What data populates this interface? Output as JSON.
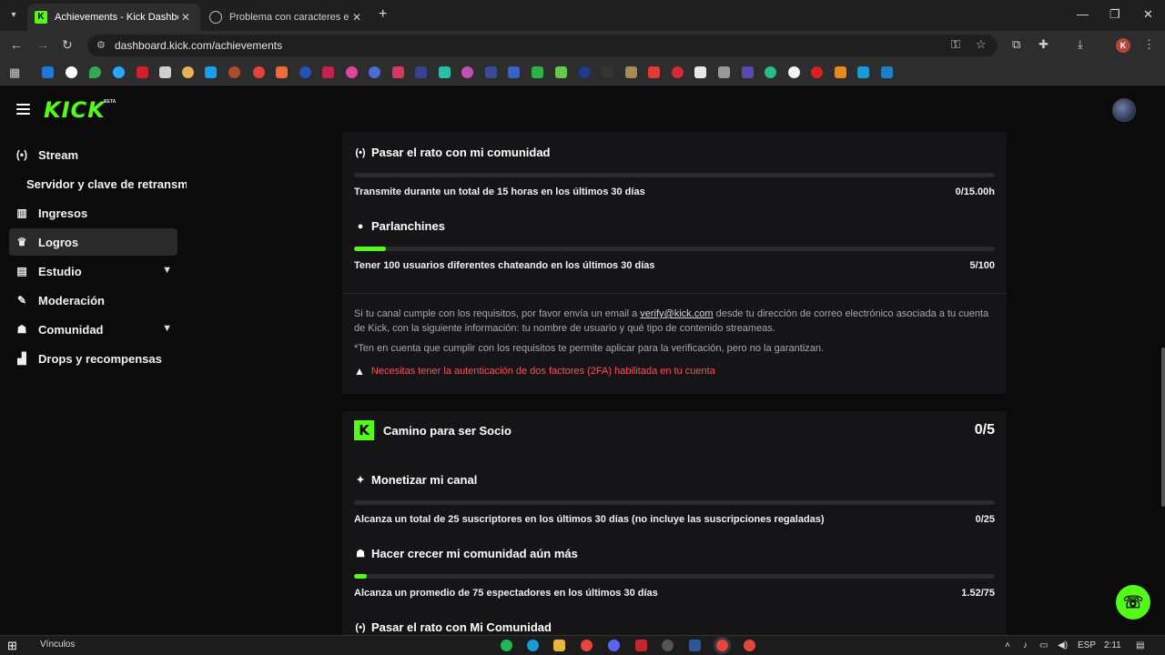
{
  "browser": {
    "tabs": [
      {
        "title": "Achievements - Kick Dashboard",
        "active": true
      },
      {
        "title": "Problema con caracteres espec",
        "active": false
      }
    ],
    "url": "dashboard.kick.com/achievements"
  },
  "app": {
    "logo": "KICK",
    "logo_badge": "BETA"
  },
  "sidebar": {
    "items": [
      {
        "label": "Stream",
        "icon": "broadcast-icon"
      },
      {
        "label": "Servidor y clave de retransm",
        "icon": ""
      },
      {
        "label": "Ingresos",
        "icon": "bar-chart-icon"
      },
      {
        "label": "Logros",
        "icon": "trophy-icon"
      },
      {
        "label": "Estudio",
        "icon": "palette-icon"
      },
      {
        "label": "Moderación",
        "icon": "wrench-icon"
      },
      {
        "label": "Comunidad",
        "icon": "people-icon"
      },
      {
        "label": "Drops y recompensas",
        "icon": "gift-icon"
      }
    ]
  },
  "verification": {
    "req1": {
      "title": "Pasar el rato con mi comunidad",
      "desc": "Transmite durante un total de 15 horas en los últimos 30 días",
      "value": "0/15.00h",
      "progress": 0.0
    },
    "req2": {
      "title": "Parlanchines",
      "desc": "Tener 100 usuarios diferentes chateando en los últimos 30 días",
      "value": "5/100",
      "progress": 0.05
    },
    "info_a": "Si tu canal cumple con los requisitos, por favor envía un email a",
    "info_email": "verify@kick.com",
    "info_b": "desde tu dirección de correo electrónico asociada a tu cuenta de Kick, con la siguiente información: tu nombre de usuario y qué tipo de contenido streameas.",
    "note": "*Ten en cuenta que cumplir con los requisitos te permite aplicar para la verificación, pero no la garantizan.",
    "warning": "Necesitas tener la autenticación de dos factores (2FA) habilitada en tu cuenta"
  },
  "partner": {
    "title": "Camino para ser Socio",
    "count": "0/5",
    "req1": {
      "title": "Monetizar mi canal",
      "desc": "Alcanza un total de 25 suscriptores en los últimos 30 días (no incluye las suscripciones regaladas)",
      "value": "0/25",
      "progress": 0.0
    },
    "req2": {
      "title": "Hacer crecer mi comunidad aún más",
      "desc": "Alcanza un promedio de 75 espectadores en los últimos 30 días",
      "value": "1.52/75",
      "progress": 0.02
    },
    "req3": {
      "title": "Pasar el rato con Mi Comunidad"
    }
  },
  "taskbar": {
    "label": "Vínculos",
    "lang": "ESP",
    "time": "2:11"
  },
  "colors": {
    "accent": "#53fc18",
    "warning": "#ff4f5c"
  }
}
